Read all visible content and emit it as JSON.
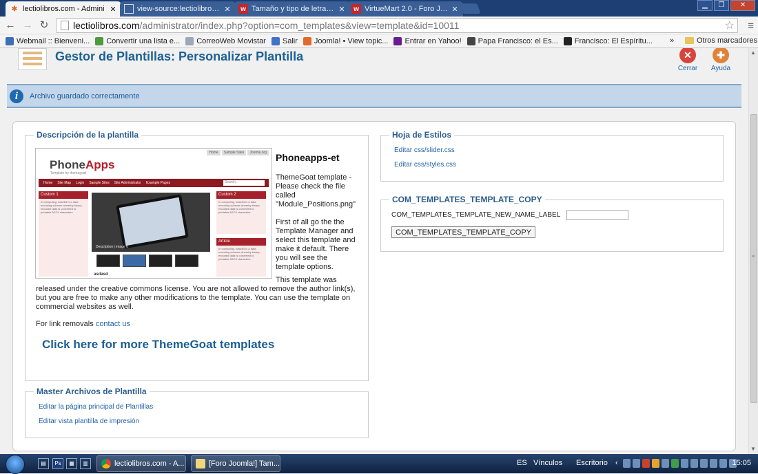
{
  "browser": {
    "tabs": [
      {
        "title": "lectiolibros.com - Admini",
        "icon": "joomla-favicon",
        "active": true
      },
      {
        "title": "view-source:lectiolibros.c",
        "icon": "page-favicon",
        "active": false
      },
      {
        "title": "Tamaño y tipo de letra Vir",
        "icon": "w-favicon",
        "active": false
      },
      {
        "title": "VirtueMart 2.0 - Foro Joom",
        "icon": "w-favicon",
        "active": false
      }
    ],
    "url_host": "lectiolibros.com",
    "url_rest": "/administrator/index.php?option=com_templates&view=template&id=10011",
    "bookmarks": [
      {
        "label": "Webmail :: Bienveni...",
        "icon": "webmail-icon",
        "color": "#3d6fb6"
      },
      {
        "label": "Convertir una lista e...",
        "icon": "et-icon",
        "color": "#4f9a3a"
      },
      {
        "label": "CorreoWeb Movistar",
        "icon": "page-icon",
        "color": "#9aa8b8"
      },
      {
        "label": "Salir",
        "icon": "s-icon",
        "color": "#3f73c8"
      },
      {
        "label": "Joomla! • View topic...",
        "icon": "joomla-icon",
        "color": "#e06a2b"
      },
      {
        "label": "Entrar en Yahoo!",
        "icon": "yahoo-icon",
        "color": "#6a1b8e"
      },
      {
        "label": "Papa Francisco: el Es...",
        "icon": "rel-icon",
        "color": "#444444"
      },
      {
        "label": "Francisco: El Espíritu...",
        "icon": "l-icon",
        "color": "#222222"
      }
    ],
    "bookmarks_more": "»",
    "other_bookmarks": "Otros marcadores"
  },
  "header": {
    "title": "Gestor de Plantillas: Personalizar Plantilla",
    "toolbar": [
      {
        "label": "Cerrar",
        "icon": "close-icon",
        "color": "#d9443a"
      },
      {
        "label": "Ayuda",
        "icon": "help-icon",
        "color": "#e0833a"
      }
    ]
  },
  "message": "Archivo guardado correctamente",
  "description": {
    "legend": "Descripción de la plantilla",
    "preview": {
      "logo_a": "Phone",
      "logo_b": "Apps",
      "tagline": "Template by themegoat",
      "top_links": [
        "Home",
        "Sample Sites",
        "Joomla.org"
      ],
      "nav": [
        "Home",
        "Site Map",
        "Login",
        "Sample Sites",
        "Site Administrator",
        "Example Pages"
      ],
      "search": "Search...",
      "custom1": "Custom 1",
      "custom2": "Custom 2",
      "article": "Article",
      "col_text": "In computing, base64 is a data encoding scheme whereby binary-encoded data is converted to printable ASCII characters.",
      "main_caption": "Description | image 0",
      "below_caption": "asdasd"
    },
    "name": "Phoneapps-et",
    "para1": "ThemeGoat template - Please check the file called \"Module_Positions.png\"",
    "para2": "First of all go the the Template Manager and select this template and make it default. There you will see the template options.",
    "para3a": "This template was",
    "para3b": "released under the creative commons license. You are not allowed to remove the author link(s), but you are free to make any other modifications to the template. You can use the template on commercial websites as well.",
    "removal_text": "For link removals",
    "removal_link": "contact us",
    "big_link": "Click here for more ThemeGoat templates"
  },
  "master": {
    "legend": "Master Archivos de Plantilla",
    "links": [
      "Editar la página principal de Plantillas",
      "Editar vista plantilla de impresión"
    ]
  },
  "styles": {
    "legend": "Hoja de Estilos",
    "links": [
      "Editar css/slider.css",
      "Editar css/styles.css"
    ]
  },
  "copy": {
    "legend": "COM_TEMPLATES_TEMPLATE_COPY",
    "label": "COM_TEMPLATES_TEMPLATE_NEW_NAME_LABEL",
    "input_value": "",
    "button": "COM_TEMPLATES_TEMPLATE_COPY"
  },
  "taskbar": {
    "tasks": [
      {
        "label": "lectiolibros.com - A...",
        "icon": "chrome-icon"
      },
      {
        "label": "[Foro Joomla!] Tam...",
        "icon": "mail-icon"
      }
    ],
    "lang": "ES",
    "vinculos": "Vínculos",
    "escritorio": "Escritorio",
    "time": "15:05"
  }
}
